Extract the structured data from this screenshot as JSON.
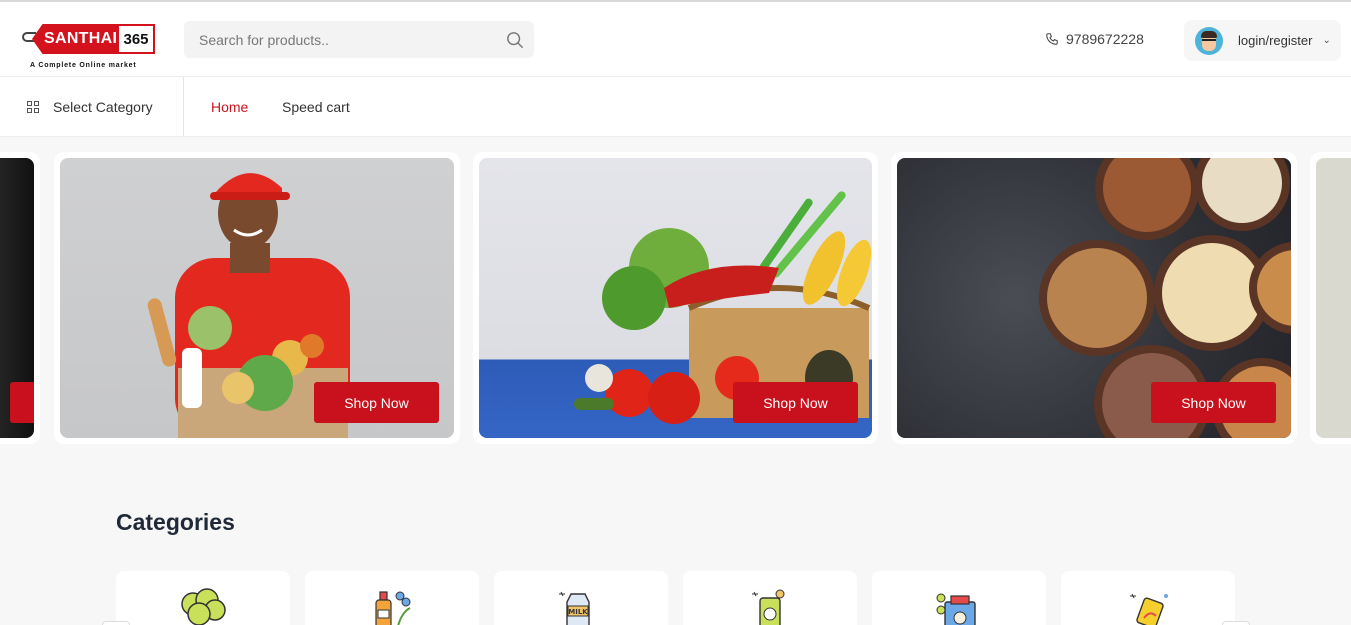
{
  "brand": {
    "logo_text": "SANTHAI",
    "logo_number": "365",
    "tagline": "A Complete Online market"
  },
  "search": {
    "placeholder": "Search for products.."
  },
  "contact": {
    "phone": "9789672228"
  },
  "account": {
    "label": "login/register"
  },
  "nav": {
    "select_category": "Select Category",
    "links": [
      {
        "label": "Home",
        "active": true
      },
      {
        "label": "Speed cart",
        "active": false
      }
    ]
  },
  "banners": [
    {
      "button": "Shop Now"
    },
    {
      "button": "Shop Now"
    },
    {
      "button": "Shop Now"
    }
  ],
  "categories": {
    "title": "Categories"
  },
  "colors": {
    "accent": "#c8111c",
    "active_link": "#c8161d",
    "heading": "#1f2937"
  }
}
